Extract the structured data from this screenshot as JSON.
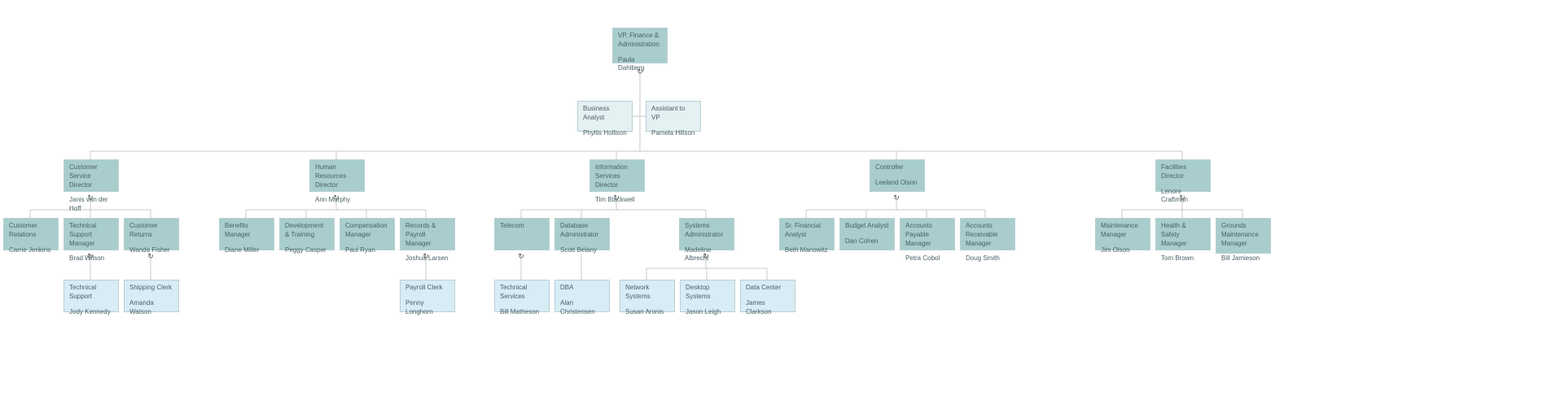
{
  "chart_data": {
    "type": "tree",
    "title": "",
    "root": {
      "title": "VP, Finance & Administration",
      "name": "Paula Dahlberg",
      "assistants": [
        {
          "title": "Business Analyst",
          "name": "Phyllis Hollison"
        },
        {
          "title": "Assistant to VP",
          "name": "Pamela Hillson"
        }
      ],
      "children": [
        {
          "title": "Customer Service Director",
          "name": "Janis van der Hoff",
          "children": [
            {
              "title": "Customer Relations",
              "name": "Carrie Jenkins"
            },
            {
              "title": "Technical Support Manager",
              "name": "Brad Wilson",
              "children": [
                {
                  "title": "Technical Support",
                  "name": "Jody Kennedy"
                }
              ]
            },
            {
              "title": "Customer Returns",
              "name": "Wanda Fisher",
              "children": [
                {
                  "title": "Shipping Clerk",
                  "name": "Amanda Watson"
                }
              ]
            }
          ]
        },
        {
          "title": "Human Resources Director",
          "name": "Ann Murphy",
          "children": [
            {
              "title": "Benefits Manager",
              "name": "Diane Miller"
            },
            {
              "title": "Development & Training",
              "name": "Peggy Casper"
            },
            {
              "title": "Compensation Manager",
              "name": "Paul Ryan"
            },
            {
              "title": "Records & Payroll Manager",
              "name": "Joshua Larsen",
              "children": [
                {
                  "title": "Payroll Clerk",
                  "name": "Penny Longhorn"
                }
              ]
            }
          ]
        },
        {
          "title": "Information Services Director",
          "name": "Tim Blackwell",
          "children": [
            {
              "title": "Telecom",
              "name": "",
              "children": [
                {
                  "title": "Technical Services",
                  "name": "Bill Matheson"
                }
              ]
            },
            {
              "title": "Database Administrator",
              "name": "Scott Belany",
              "children": [
                {
                  "title": "DBA",
                  "name": "Alan Christensen"
                }
              ]
            },
            {
              "title": "Systems Administrator",
              "name": "Madeline Albrecht",
              "children": [
                {
                  "title": "Network Systems",
                  "name": "Susan Aronis"
                },
                {
                  "title": "Desktop Systems",
                  "name": "Jason Leigh"
                },
                {
                  "title": "Data Center",
                  "name": "James Clarkson"
                }
              ]
            }
          ]
        },
        {
          "title": "Controller",
          "name": "Leeland Olson",
          "children": [
            {
              "title": "Sr. Financial Analyst",
              "name": "Beth Manowitz"
            },
            {
              "title": "Budget Analyst",
              "name": "Dan Cohen"
            },
            {
              "title": "Accounts Payable Manager",
              "name": "Petra Cobol"
            },
            {
              "title": "Accounts Receivable Manager",
              "name": "Doug Smith"
            }
          ]
        },
        {
          "title": "Facilities Director",
          "name": "Lenore Craftman",
          "children": [
            {
              "title": "Maintenance Manager",
              "name": "Jim Olson"
            },
            {
              "title": "Health & Safety Manager",
              "name": "Tom Brown"
            },
            {
              "title": "Grounds Maintenance Manager",
              "name": "Bill Jamieson"
            }
          ]
        }
      ]
    }
  },
  "icons": {
    "refresh": "↻"
  },
  "nodes": {
    "root": {
      "title": "VP, Finance & Administration",
      "name": "Paula Dahlberg"
    },
    "asst_l": {
      "title": "Business Analyst",
      "name": "Phyllis Hollison"
    },
    "asst_r": {
      "title": "Assistant to VP",
      "name": "Pamela Hillson"
    },
    "cs_dir": {
      "title": "Customer Service Director",
      "name": "Janis van der Hoff"
    },
    "hr_dir": {
      "title": "Human Resources Director",
      "name": "Ann Murphy"
    },
    "is_dir": {
      "title": "Information Services Director",
      "name": "Tim Blackwell"
    },
    "ctrl": {
      "title": "Controller",
      "name": "Leeland Olson"
    },
    "fac_dir": {
      "title": "Facilities Director",
      "name": "Lenore Craftman"
    },
    "cs1": {
      "title": "Customer Relations",
      "name": "Carrie Jenkins"
    },
    "cs2": {
      "title": "Technical Support Manager",
      "name": "Brad Wilson"
    },
    "cs3": {
      "title": "Customer Returns",
      "name": "Wanda Fisher"
    },
    "cs2a": {
      "title": "Technical Support",
      "name": "Jody Kennedy"
    },
    "cs3a": {
      "title": "Shipping Clerk",
      "name": "Amanda Watson"
    },
    "hr1": {
      "title": "Benefits Manager",
      "name": "Diane Miller"
    },
    "hr2": {
      "title": "Development & Training",
      "name": "Peggy Casper"
    },
    "hr3": {
      "title": "Compensation Manager",
      "name": "Paul Ryan"
    },
    "hr4": {
      "title": "Records & Payroll Manager",
      "name": "Joshua Larsen"
    },
    "hr4a": {
      "title": "Payroll Clerk",
      "name": "Penny Longhorn"
    },
    "is1": {
      "title": "Telecom",
      "name": ""
    },
    "is2": {
      "title": "Database Administrator",
      "name": "Scott Belany"
    },
    "is3": {
      "title": "Systems Administrator",
      "name": "Madeline Albrecht"
    },
    "is1a": {
      "title": "Technical Services",
      "name": "Bill Matheson"
    },
    "is2a": {
      "title": "DBA",
      "name": "Alan Christensen"
    },
    "is3a": {
      "title": "Network Systems",
      "name": "Susan Aronis"
    },
    "is3b": {
      "title": "Desktop Systems",
      "name": "Jason Leigh"
    },
    "is3c": {
      "title": "Data Center",
      "name": "James Clarkson"
    },
    "ct1": {
      "title": "Sr. Financial Analyst",
      "name": "Beth Manowitz"
    },
    "ct2": {
      "title": "Budget Analyst",
      "name": "Dan Cohen"
    },
    "ct3": {
      "title": "Accounts Payable Manager",
      "name": "Petra Cobol"
    },
    "ct4": {
      "title": "Accounts Receivable Manager",
      "name": "Doug Smith"
    },
    "fa1": {
      "title": "Maintenance Manager",
      "name": "Jim Olson"
    },
    "fa2": {
      "title": "Health & Safety Manager",
      "name": "Tom Brown"
    },
    "fa3": {
      "title": "Grounds Maintenance Manager",
      "name": "Bill Jamieson"
    }
  }
}
